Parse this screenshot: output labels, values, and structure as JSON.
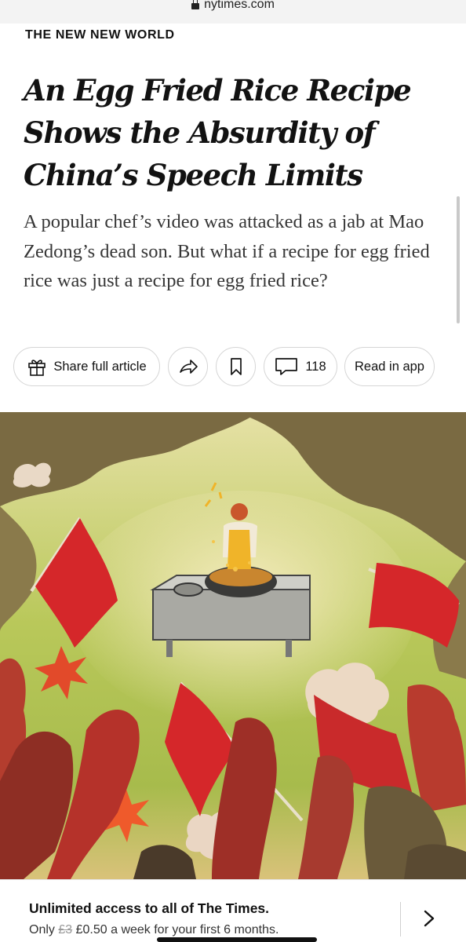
{
  "browser": {
    "url": "nytimes.com"
  },
  "article": {
    "kicker": "THE NEW NEW WORLD",
    "headline_lines": [
      "An Egg Fried Rice Recipe",
      "Shows the Absurdity of",
      "China’s Speech Limits"
    ],
    "dek": "A popular chef’s video was attacked as a jab at Mao Zedong’s dead son. But what if a recipe for egg fried rice was just a recipe for egg fried rice?"
  },
  "actions": {
    "share_label": "Share full article",
    "comments_count": "118",
    "read_in_app_label": "Read in app"
  },
  "icons": {
    "share": "gift-icon",
    "forward": "forward-arrow-icon",
    "save": "bookmark-icon",
    "comments": "comment-bubble-icon",
    "next": "chevron-right-icon",
    "lock": "lock-icon"
  },
  "banner": {
    "title": "Unlimited access to all of The Times.",
    "only": "Only",
    "old_price": "£3",
    "offer": "£0.50 a week for your first 6 months."
  },
  "colors": {
    "flag_red": "#d5272a",
    "smoke_green": "#b9c85a",
    "apron_yellow": "#f0b429"
  }
}
